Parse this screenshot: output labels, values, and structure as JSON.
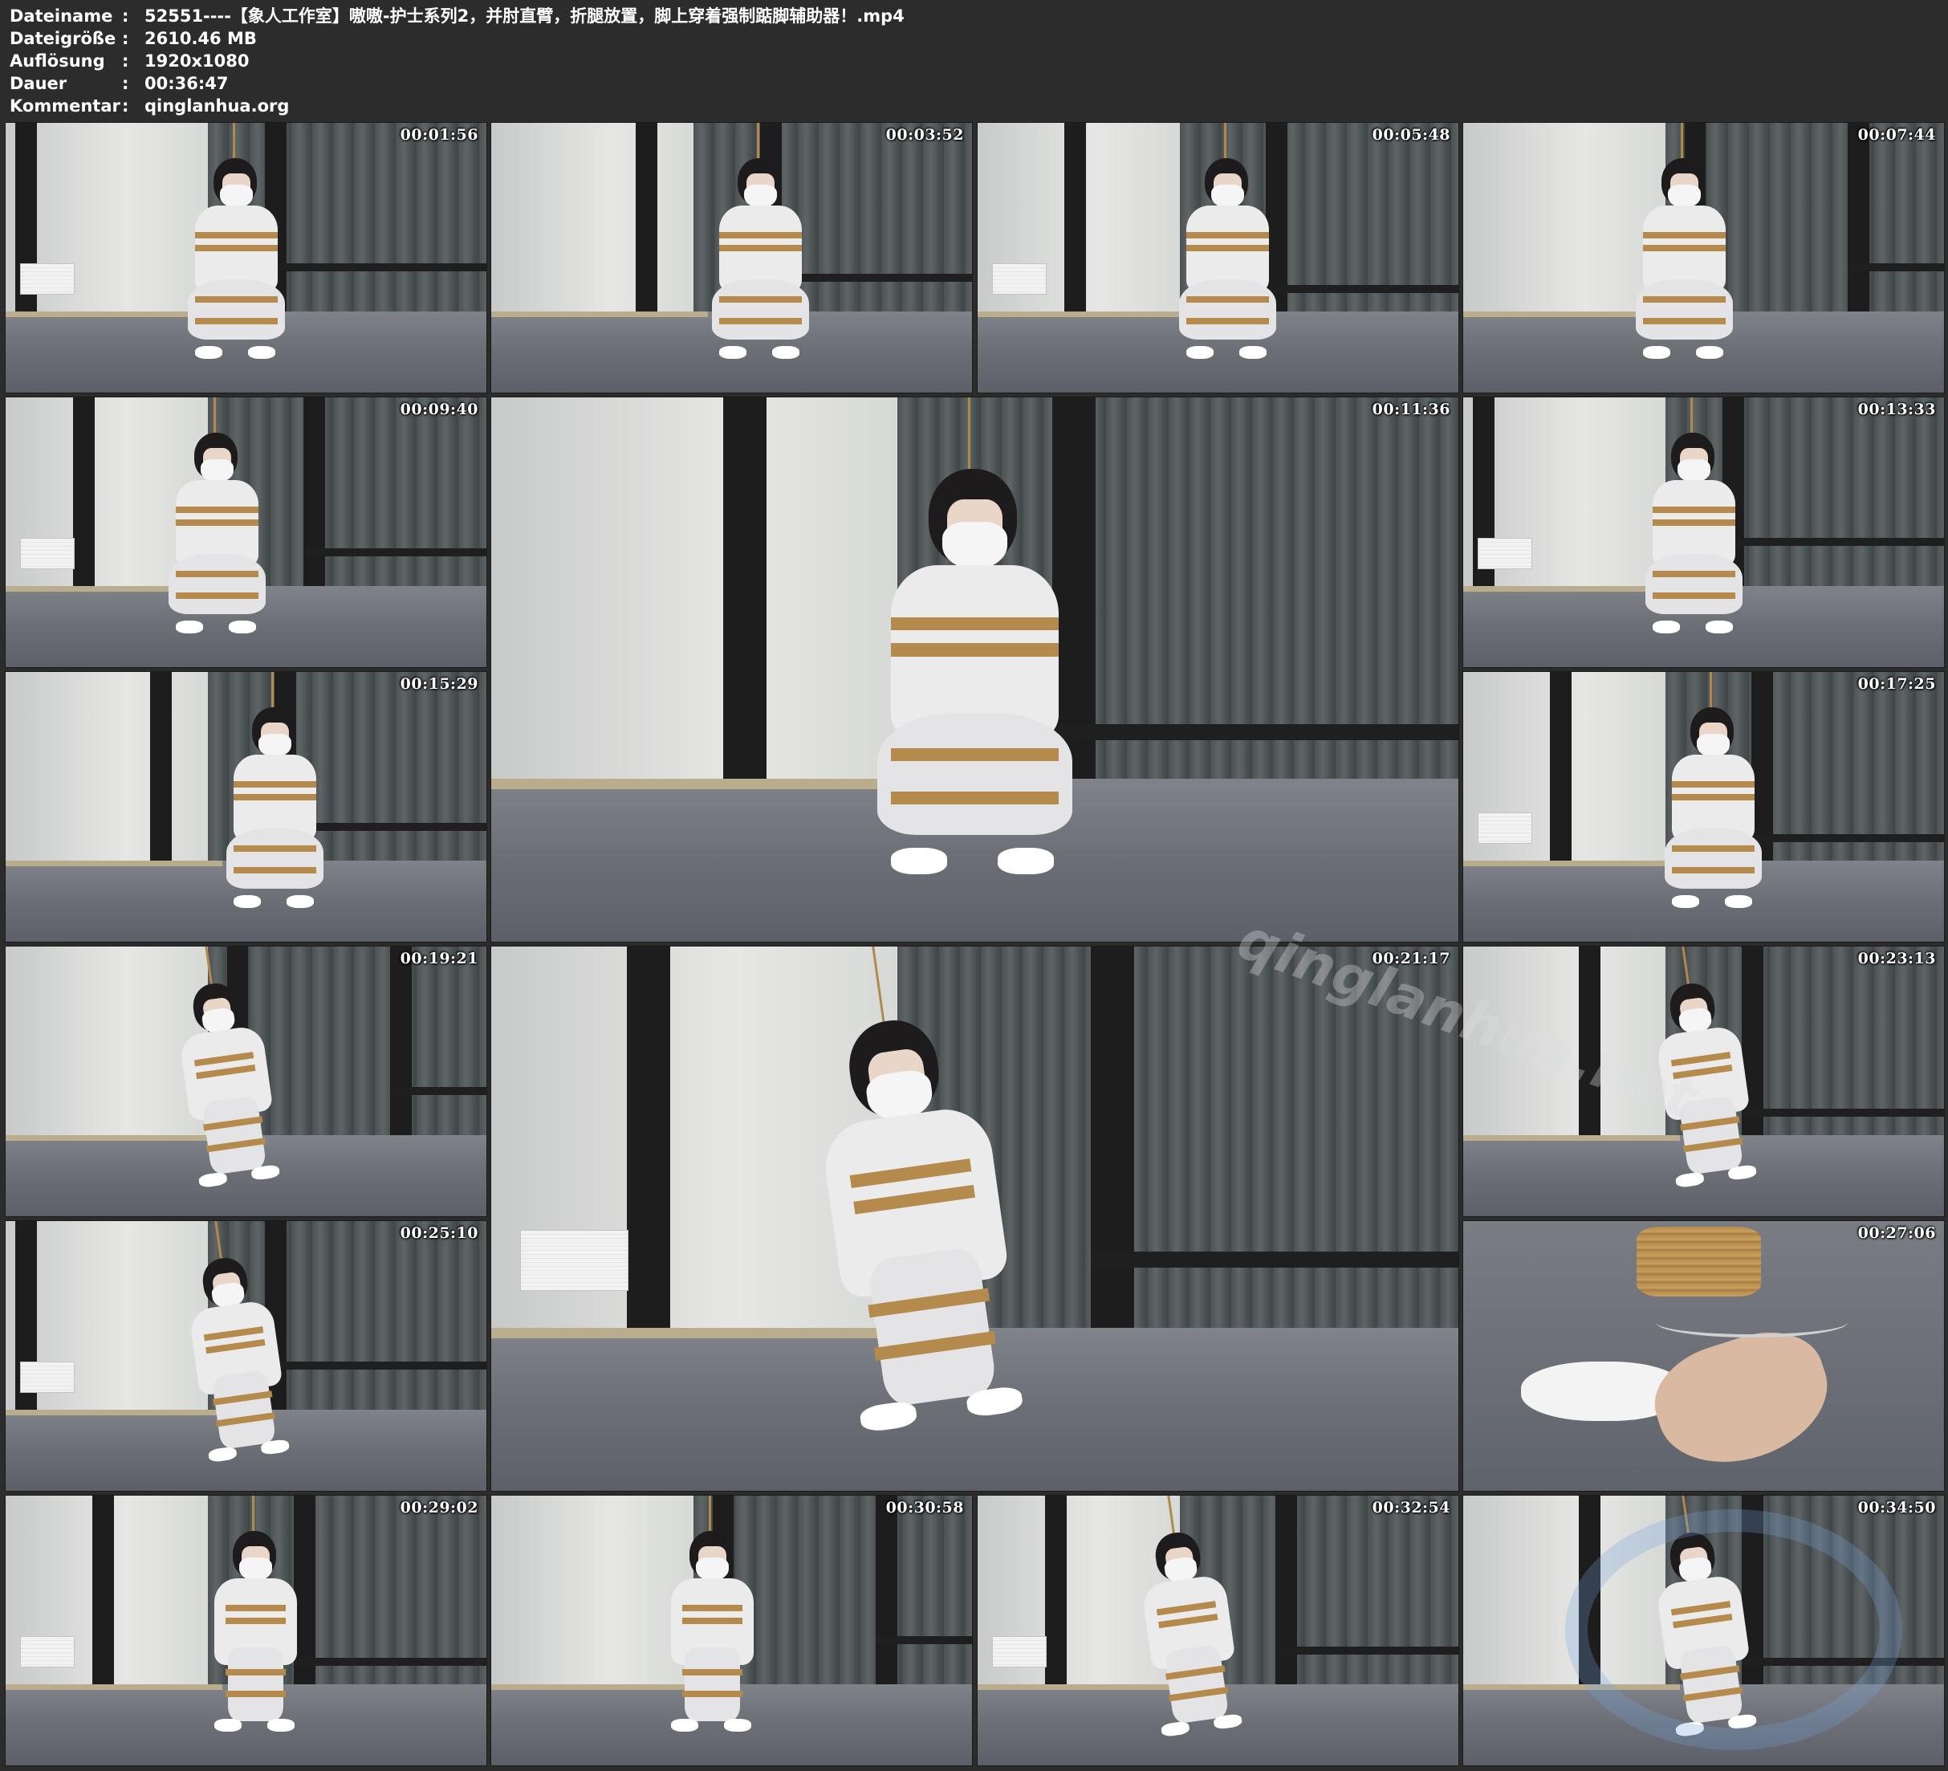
{
  "header": {
    "rows": [
      {
        "label": "Dateiname",
        "sep": ":",
        "value": "52551----【象人工作室】嗷嗷-护士系列2，并肘直臂，折腿放置，脚上穿着强制踮脚辅助器！.mp4"
      },
      {
        "label": "Dateigröße",
        "sep": ":",
        "value": "2610.46 MB"
      },
      {
        "label": "Auflösung",
        "sep": ":",
        "value": "1920x1080"
      },
      {
        "label": "Dauer",
        "sep": ":",
        "value": "00:36:47"
      },
      {
        "label": "Kommentar",
        "sep": ":",
        "value": "qinglanhua.org"
      }
    ]
  },
  "thumbnails": [
    {
      "timestamp": "00:01:56",
      "pose": "squat"
    },
    {
      "timestamp": "00:03:52",
      "pose": "squat"
    },
    {
      "timestamp": "00:05:48",
      "pose": "squat"
    },
    {
      "timestamp": "00:07:44",
      "pose": "squat"
    },
    {
      "timestamp": "00:09:40",
      "pose": "squat"
    },
    {
      "timestamp": "00:11:36",
      "pose": "squat"
    },
    {
      "timestamp": "00:13:33",
      "pose": "squat"
    },
    {
      "timestamp": "00:15:29",
      "pose": "squat"
    },
    {
      "timestamp": "00:17:25",
      "pose": "squat"
    },
    {
      "timestamp": "00:19:21",
      "pose": "bent"
    },
    {
      "timestamp": "00:21:17",
      "pose": "bent"
    },
    {
      "timestamp": "00:23:13",
      "pose": "bent"
    },
    {
      "timestamp": "00:25:10",
      "pose": "bent"
    },
    {
      "timestamp": "00:27:06",
      "pose": "closeup-feet"
    },
    {
      "timestamp": "00:29:02",
      "pose": "standing"
    },
    {
      "timestamp": "00:30:58",
      "pose": "standing"
    },
    {
      "timestamp": "00:32:54",
      "pose": "bent"
    },
    {
      "timestamp": "00:34:50",
      "pose": "bent"
    }
  ],
  "watermarks": {
    "large_text": "qinglanhua.net"
  },
  "colors": {
    "background": "#2c2c2c",
    "text": "#ffffff",
    "rope": "#b48b4d",
    "curtain": "#4c5253",
    "floor": "#6b6e75"
  }
}
